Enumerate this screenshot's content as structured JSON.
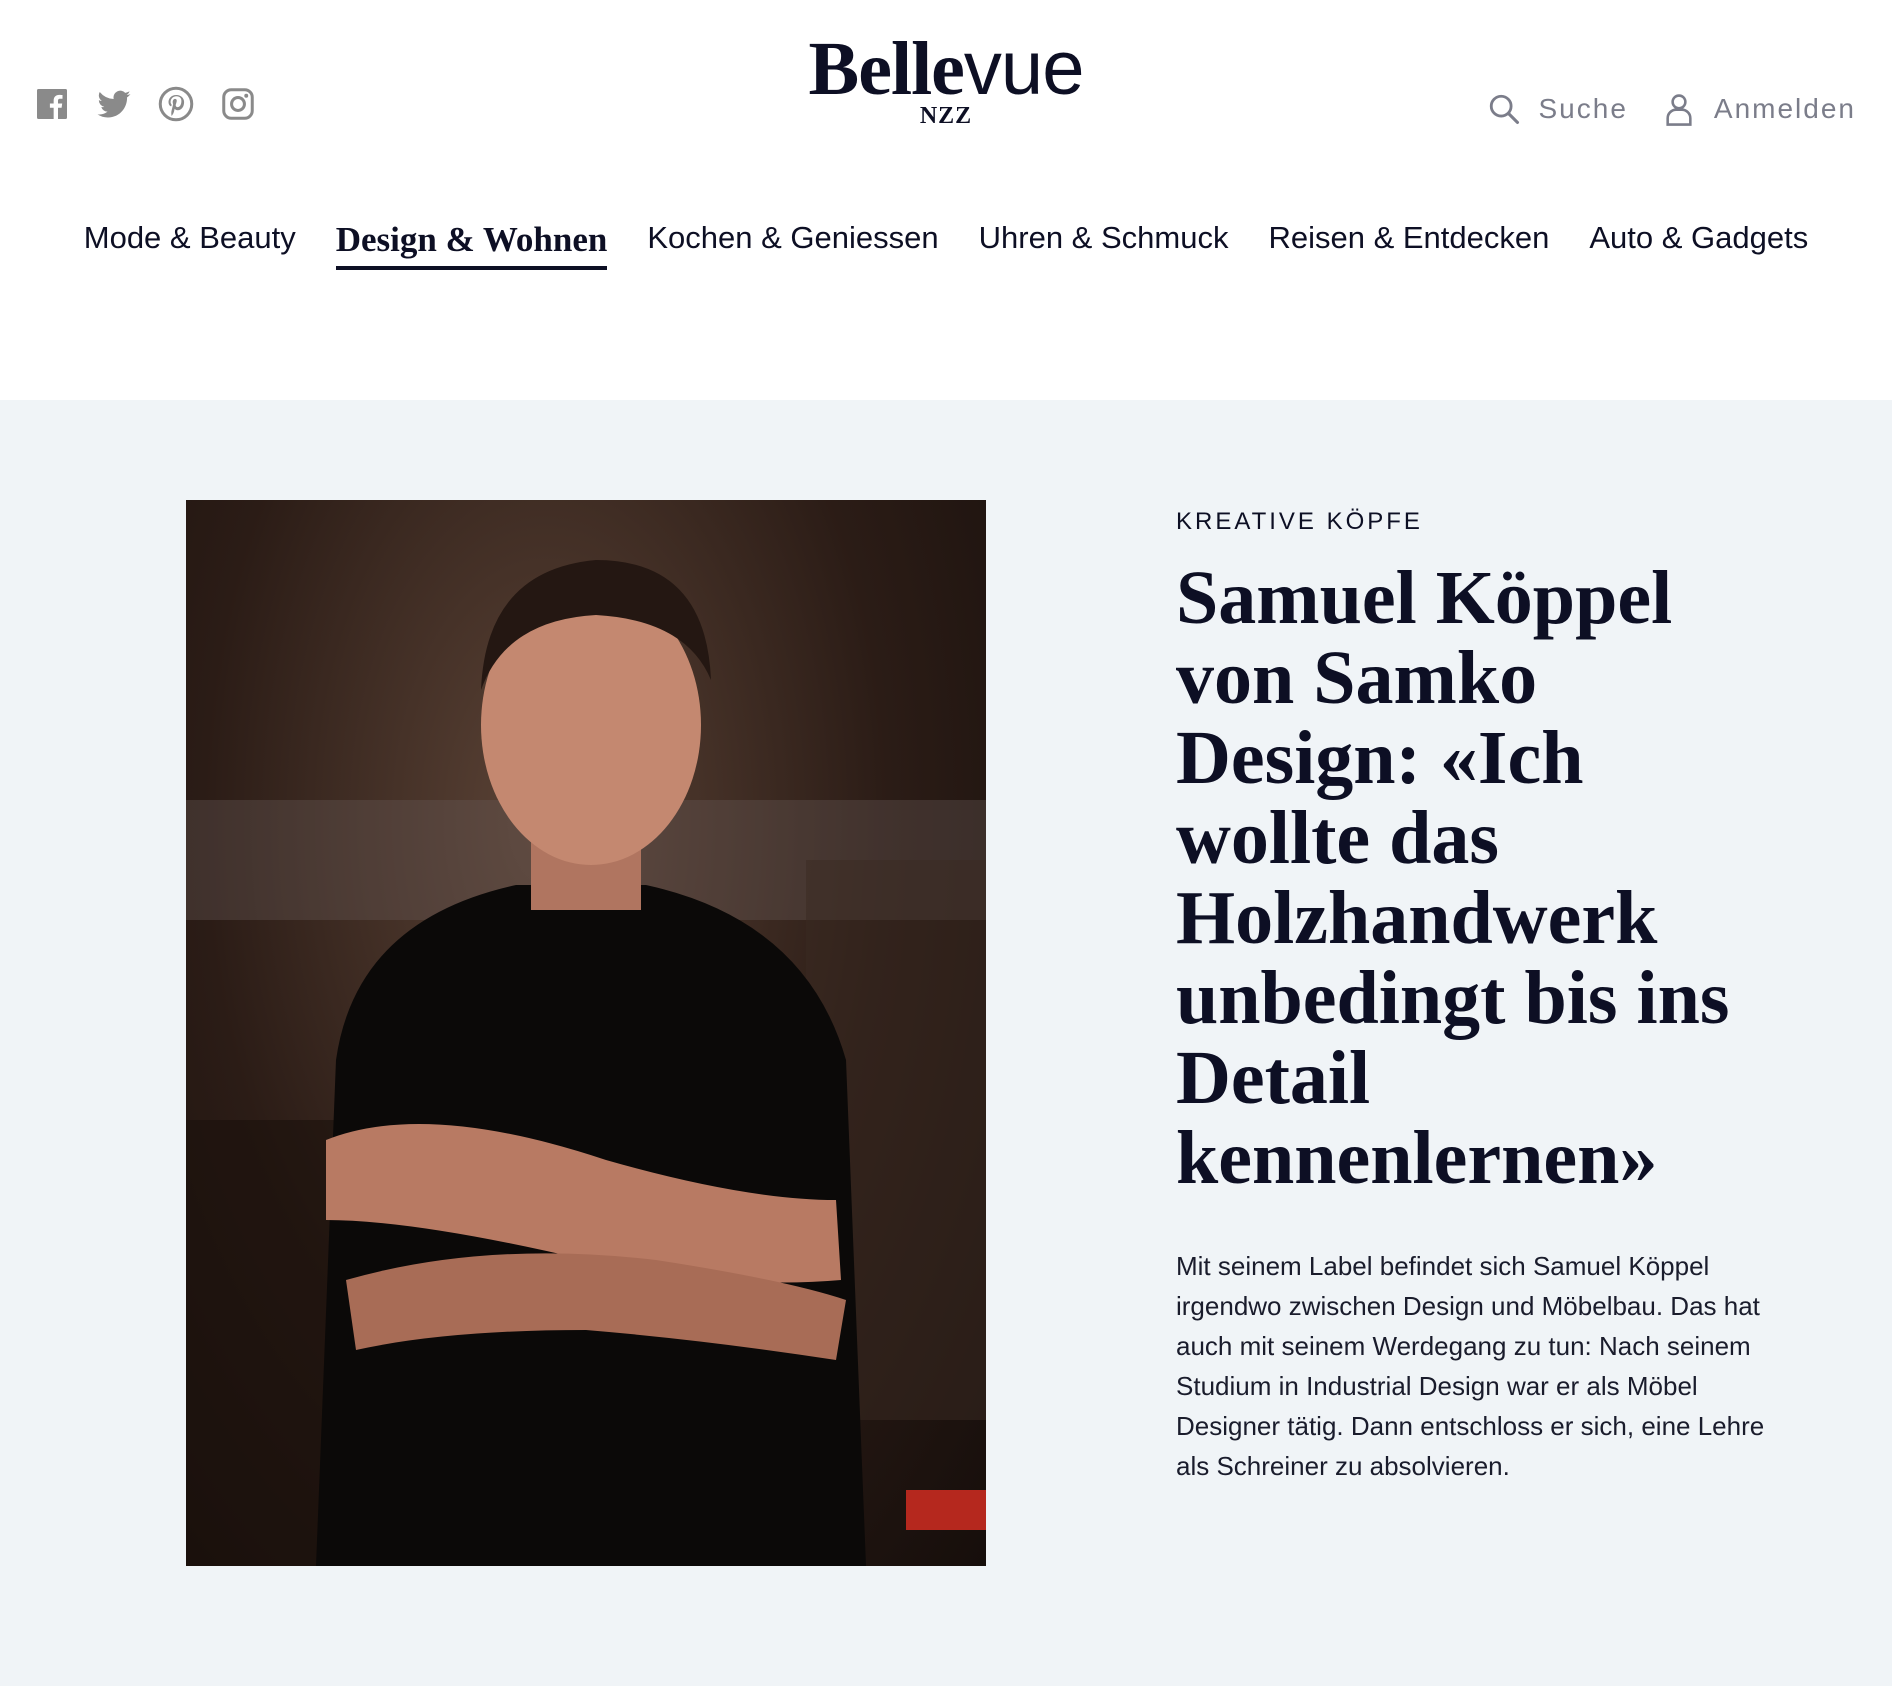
{
  "social": {
    "icons": [
      "facebook-icon",
      "twitter-icon",
      "pinterest-icon",
      "instagram-icon"
    ]
  },
  "logo": {
    "word_bold": "Belle",
    "word_light": "vue",
    "sub": "NZZ"
  },
  "header_tools": {
    "search_label": "Suche",
    "search_icon": "search-icon",
    "login_label": "Anmelden",
    "login_icon": "user-icon"
  },
  "nav": {
    "items": [
      {
        "label": "Mode & Beauty",
        "active": false
      },
      {
        "label": "Design & Wohnen",
        "active": true
      },
      {
        "label": "Kochen & Geniessen",
        "active": false
      },
      {
        "label": "Uhren & Schmuck",
        "active": false
      },
      {
        "label": "Reisen & Entdecken",
        "active": false
      },
      {
        "label": "Auto & Gadgets",
        "active": false
      }
    ]
  },
  "article": {
    "kicker": "KREATIVE KÖPFE",
    "headline": "Samuel Köppel von Samko Design: «Ich wollte das Holzhandwerk unbedingt bis ins Detail kennenlernen»",
    "lead": "Mit seinem Label befindet sich Samuel Köppel irgendwo zwischen Design und Möbelbau. Das hat auch mit seinem Werdegang zu tun: Nach seinem Studium in Industrial Design war er als Möbel Designer tätig. Dann entschloss er sich, eine Lehre als Schreiner zu absolvieren."
  },
  "colors": {
    "text": "#0d0f24",
    "muted": "#7b7d8a",
    "hero_background": "#f0f4f7"
  }
}
